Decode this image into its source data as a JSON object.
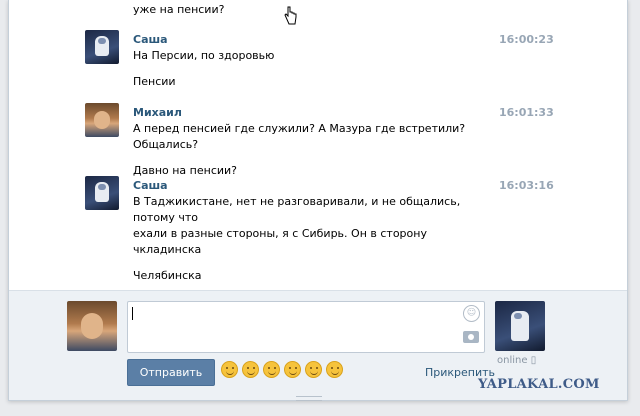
{
  "history": {
    "prev_line": "уже на пенсии?",
    "messages": [
      {
        "author": "Саша",
        "time": "16:00:23",
        "lines": [
          "На Персии, по здоровью"
        ],
        "extra": "Пенсии"
      },
      {
        "author": "Михаил",
        "time": "16:01:33",
        "lines": [
          "А перед пенсией где служили? А Мазура где встретили? Общались?"
        ],
        "extra": "Давно на пенсии?"
      },
      {
        "author": "Саша",
        "time": "16:03:16",
        "lines": [
          "В Таджикистане, нет не разговаривали, и не общались, потому что",
          "ехали в разные стороны, я с Сибирь. Он в сторону чкладинска"
        ],
        "extra": "Челябинска"
      }
    ]
  },
  "composer": {
    "input_value": "",
    "send_label": "Отправить",
    "attach_label": "Прикрепить",
    "status": "online",
    "emojis": [
      "smile",
      "wink",
      "grin",
      "scream",
      "blush",
      "surprised"
    ]
  },
  "watermark": "YAPLAKAL.COM"
}
